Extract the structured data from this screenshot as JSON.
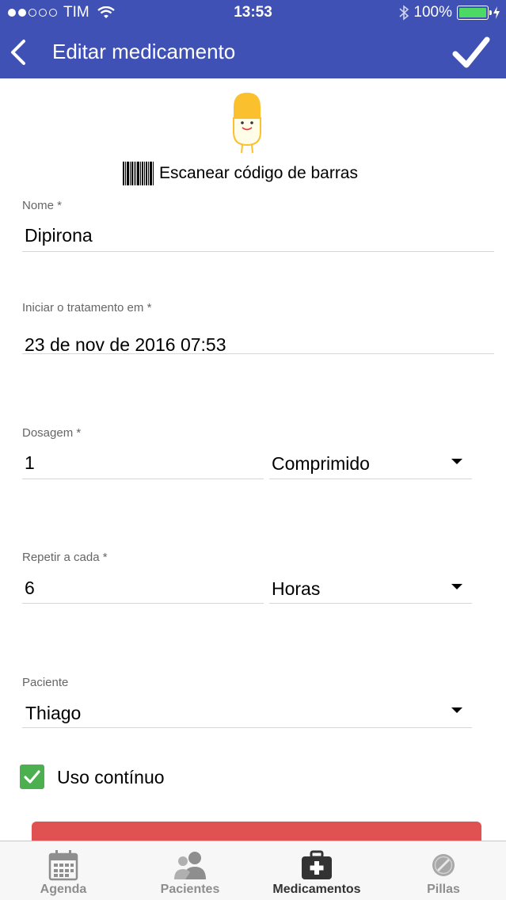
{
  "status_bar": {
    "carrier": "TIM",
    "time": "13:53",
    "battery": "100%"
  },
  "header": {
    "title": "Editar medicamento"
  },
  "barcode": {
    "label": "Escanear código de barras"
  },
  "fields": {
    "nome": {
      "label": "Nome *",
      "value": "Dipirona"
    },
    "inicio": {
      "label": "Iniciar o tratamento em *",
      "value": "23 de nov de 2016 07:53"
    },
    "dosagem": {
      "label": "Dosagem *",
      "value": "1",
      "unit": "Comprimido"
    },
    "repetir": {
      "label": "Repetir a cada *",
      "value": "6",
      "unit": "Horas"
    },
    "paciente": {
      "label": "Paciente",
      "value": "Thiago"
    }
  },
  "uso_continuo": {
    "label": "Uso contínuo",
    "checked": true
  },
  "tabs": [
    {
      "label": "Agenda",
      "icon": "calendar-icon",
      "active": false
    },
    {
      "label": "Pacientes",
      "icon": "people-icon",
      "active": false
    },
    {
      "label": "Medicamentos",
      "icon": "medkit-icon",
      "active": true
    },
    {
      "label": "Pillas",
      "icon": "coin-icon",
      "active": false
    }
  ],
  "colors": {
    "header": "#3f51b5",
    "checkbox": "#4caf50",
    "delete_button": "#e05252",
    "pill": "#fbc02d"
  }
}
